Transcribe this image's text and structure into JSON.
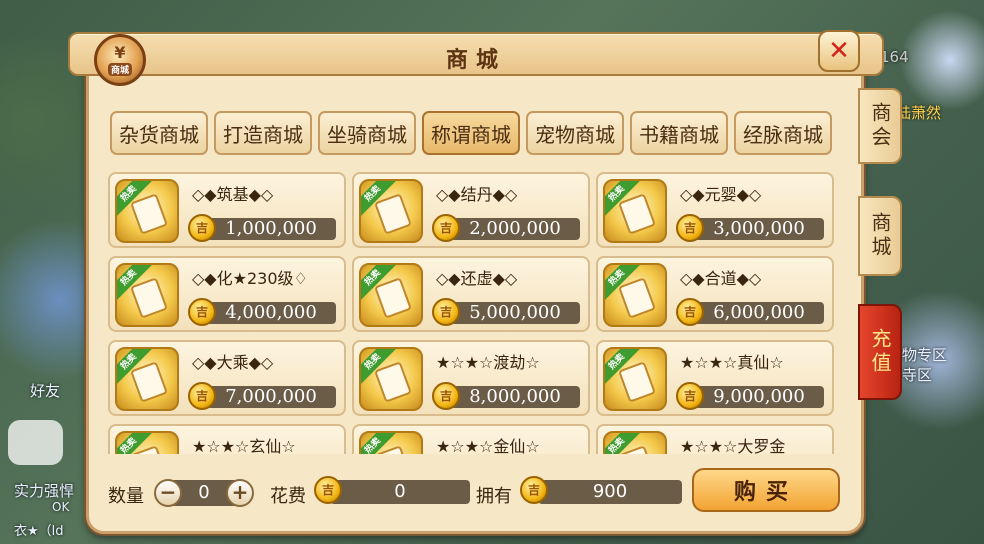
{
  "background": {
    "texts": [
      "实力强悍",
      "好友",
      "陆萧然",
      "物专区",
      "寺区",
      "衣★（ld",
      "OK",
      "164"
    ]
  },
  "header": {
    "title": "商城",
    "logo_label": "商城",
    "logo_symbol": "¥"
  },
  "categories": [
    {
      "label": "杂货商城",
      "active": false
    },
    {
      "label": "打造商城",
      "active": false
    },
    {
      "label": "坐骑商城",
      "active": false
    },
    {
      "label": "称谓商城",
      "active": true
    },
    {
      "label": "宠物商城",
      "active": false
    },
    {
      "label": "书籍商城",
      "active": false
    },
    {
      "label": "经脉商城",
      "active": false
    }
  ],
  "side_tabs": [
    "商会",
    "商城",
    "充值"
  ],
  "items": [
    {
      "name": "◇◆筑基◆◇",
      "price": "1,000,000",
      "badge": "热卖"
    },
    {
      "name": "◇◆结丹◆◇",
      "price": "2,000,000",
      "badge": "热卖"
    },
    {
      "name": "◇◆元婴◆◇",
      "price": "3,000,000",
      "badge": "热卖"
    },
    {
      "name": "◇◆化★230级♢",
      "price": "4,000,000",
      "badge": "热卖"
    },
    {
      "name": "◇◆还虚◆◇",
      "price": "5,000,000",
      "badge": "热卖"
    },
    {
      "name": "◇◆合道◆◇",
      "price": "6,000,000",
      "badge": "热卖"
    },
    {
      "name": "◇◆大乘◆◇",
      "price": "7,000,000",
      "badge": "热卖"
    },
    {
      "name": "★☆★☆渡劫☆",
      "price": "8,000,000",
      "badge": "热卖"
    },
    {
      "name": "★☆★☆真仙☆",
      "price": "9,000,000",
      "badge": "热卖"
    },
    {
      "name": "★☆★☆玄仙☆",
      "price": "",
      "badge": "热卖"
    },
    {
      "name": "★☆★☆金仙☆",
      "price": "",
      "badge": "热卖"
    },
    {
      "name": "★☆★☆大罗金",
      "price": "",
      "badge": "热卖"
    }
  ],
  "bottom": {
    "quantity_label": "数量",
    "quantity_value": "0",
    "minus": "−",
    "plus": "+",
    "cost_label": "花费",
    "cost_value": "0",
    "own_label": "拥有",
    "own_value": "900",
    "buy_label": "购买"
  },
  "colors": {
    "panel": "#f6e7c6",
    "price_bar": "#6b5c47",
    "hot_badge": "#3f9c2e",
    "recharge": "#d33a22"
  }
}
